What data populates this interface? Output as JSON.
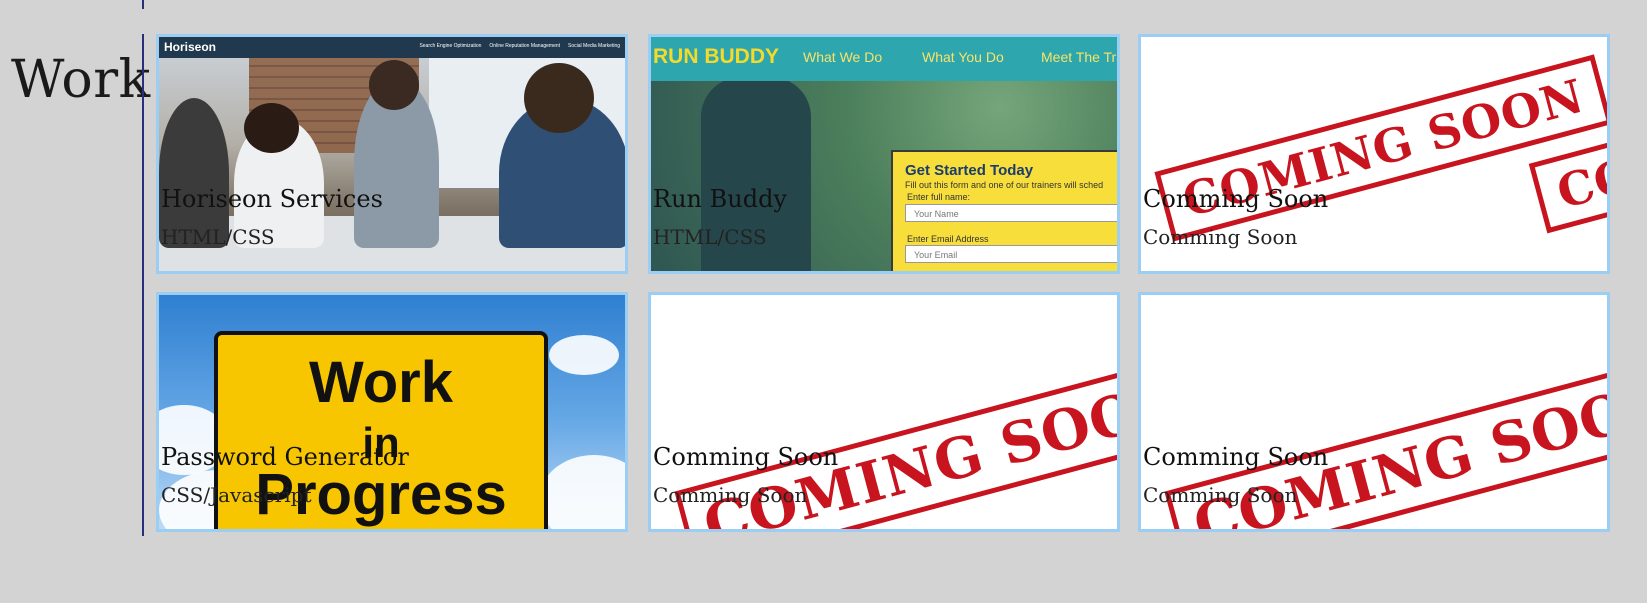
{
  "section": {
    "title": "Work"
  },
  "projects": [
    {
      "title": "Horiseon Services",
      "tech": "HTML/CSS",
      "thumb": {
        "logo": "Horiseon",
        "nav": [
          "Search Engine Optimization",
          "Online Reputation Management",
          "Social Media Marketing"
        ]
      }
    },
    {
      "title": "Run Buddy",
      "tech": "HTML/CSS",
      "thumb": {
        "logo": "RUN BUDDY",
        "nav": [
          "What We Do",
          "What You Do",
          "Meet The Tra"
        ],
        "form_title": "Get Started Today",
        "form_sub": "Fill out this form and one of our trainers will sched",
        "name_label": "Enter full name:",
        "name_placeholder": "Your Name",
        "email_label": "Enter Email Address",
        "email_placeholder": "Your Email"
      }
    },
    {
      "title": "Comming Soon",
      "tech": "Comming Soon",
      "stamp": "COMING SOON",
      "stamp_partial": "CO"
    },
    {
      "title": "Password Generator",
      "tech": "CSS/Javascript",
      "sign": [
        "Work",
        "in",
        "Progress"
      ]
    },
    {
      "title": "Comming Soon",
      "tech": "Comming Soon",
      "stamp": "COMING SOON"
    },
    {
      "title": "Comming Soon",
      "tech": "Comming Soon",
      "stamp": "COMING SOON"
    }
  ],
  "colors": {
    "background": "#d3d3d3",
    "card_border": "#9ccdf3",
    "rule": "#2b2f7a",
    "stamp": "#c8141e",
    "sign": "#f7c600"
  }
}
